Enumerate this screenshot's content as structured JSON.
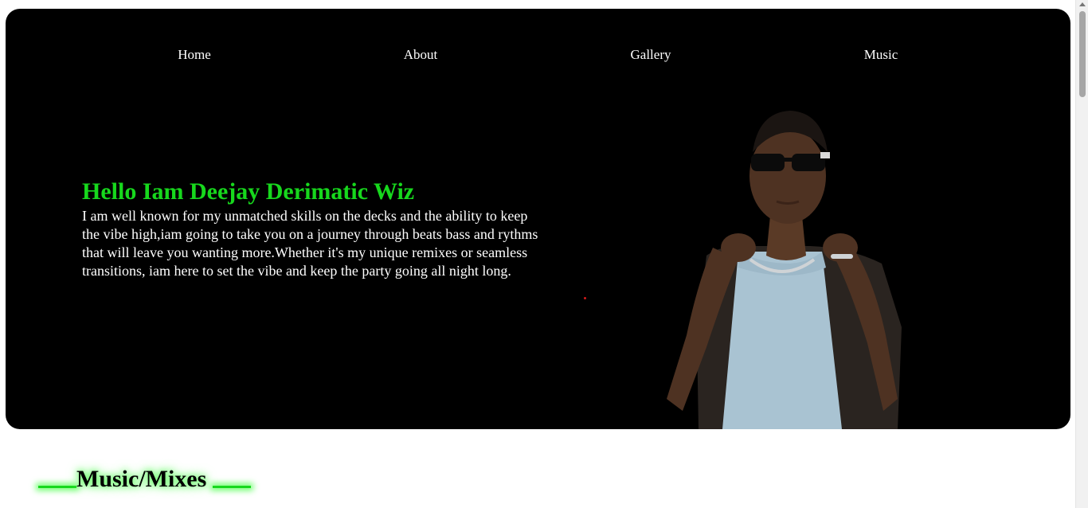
{
  "nav": {
    "items": [
      "Home",
      "About",
      "Gallery",
      "Music"
    ]
  },
  "hero": {
    "title": "Hello Iam Deejay Derimatic Wiz",
    "description": "I am well known for my unmatched skills on the decks and the ability to keep the vibe high,iam going to take you on a journey through beats bass and rythms that will leave you wanting more.Whether it's my unique remixes or seamless transitions, iam here to set the vibe and keep the party going all night long."
  },
  "section": {
    "title": "Music/Mixes"
  },
  "colors": {
    "accent": "#17d81d",
    "hero_bg": "#000000"
  },
  "icons": {
    "portrait": "dj-portrait-photo"
  }
}
